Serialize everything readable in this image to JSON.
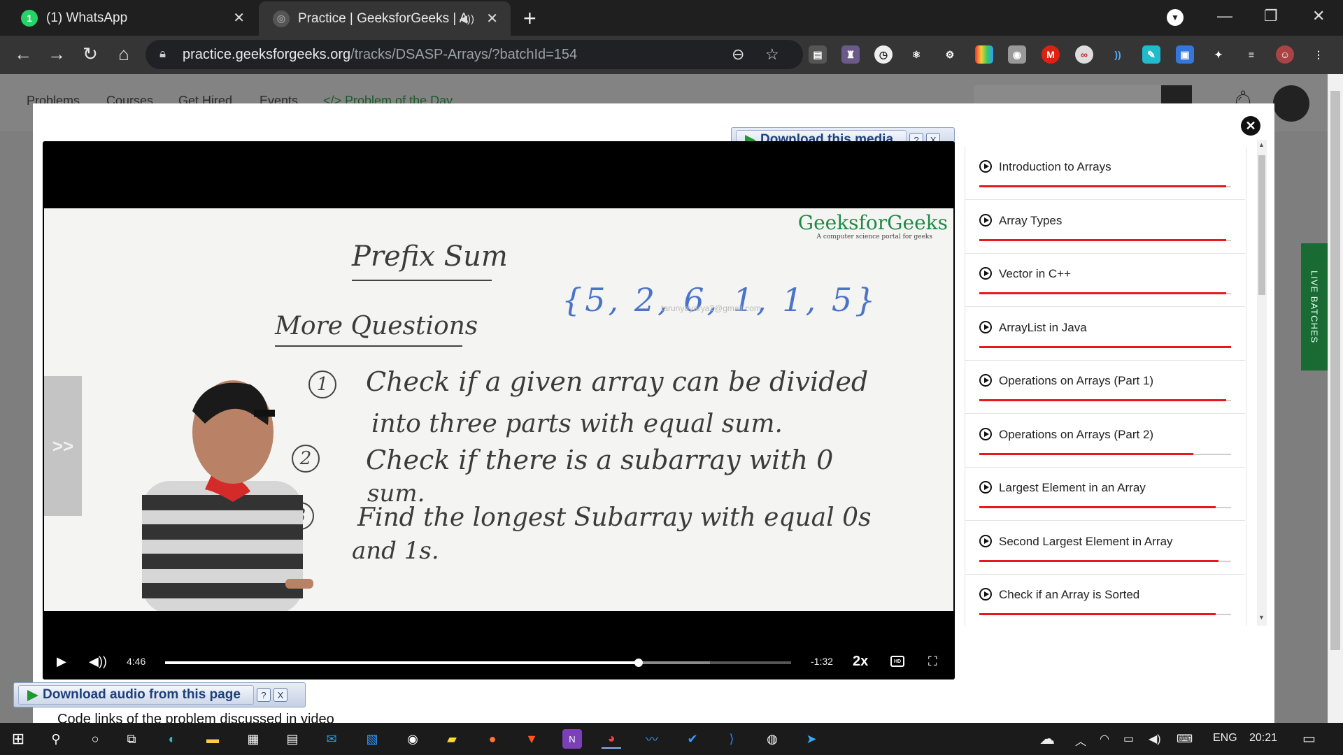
{
  "tabs": [
    {
      "title": "(1) WhatsApp",
      "badge": "1"
    },
    {
      "title": "Practice | GeeksforGeeks | A"
    }
  ],
  "window": {
    "minimize": "—",
    "restore": "❐",
    "close": "✕"
  },
  "address": {
    "host": "practice.geeksforgeeks.org",
    "path": "/tracks/DSASP-Arrays/?batchId=154"
  },
  "site_nav": {
    "problems": "Problems",
    "courses": "Courses",
    "get_hired": "Get Hired",
    "events": "Events",
    "potd": "</> Problem of the Day",
    "live": "LIVE BATCHES"
  },
  "media": {
    "download_media": "Download this media",
    "download_audio": "Download audio from this page",
    "help": "?",
    "close": "X"
  },
  "video": {
    "watermark": "GeeksforGeeks",
    "watermark_sub": "A computer science portal for geeks",
    "email": "tarunyayarya2@gmail.com",
    "board": {
      "title": "Prefix Sum",
      "array": "{5, 2, 6, 1, 1, 5}",
      "subtitle": "More Questions",
      "n1": "1",
      "q1a": "Check if a given array can be divided",
      "q1b": "into three parts with equal sum.",
      "n2": "2",
      "q2a": "Check if there is a subarray with 0",
      "q2b": "sum.",
      "n3": "3",
      "q3a": "Find the longest Subarray with equal 0s",
      "q3b": "and 1s."
    },
    "side_handle": ">>",
    "elapsed": "4:46",
    "remaining": "-1:32",
    "progress": 0.756,
    "speed": "2x",
    "hd": "HD"
  },
  "playlist": [
    {
      "title": "Introduction to Arrays",
      "progress": 0.98
    },
    {
      "title": "Array Types",
      "progress": 0.98
    },
    {
      "title": "Vector in C++",
      "progress": 0.98
    },
    {
      "title": "ArrayList in Java",
      "progress": 1.0
    },
    {
      "title": "Operations on Arrays (Part 1)",
      "progress": 0.98
    },
    {
      "title": "Operations on Arrays (Part 2)",
      "progress": 0.85
    },
    {
      "title": "Largest Element in an Array",
      "progress": 0.94
    },
    {
      "title": "Second Largest Element in Array",
      "progress": 0.95
    },
    {
      "title": "Check if an Array is Sorted",
      "progress": 0.94
    }
  ],
  "below_video": "Code links of the problem discussed in video",
  "taskbar": {
    "lang": "ENG",
    "time": "20:21"
  },
  "colors": {
    "gfg_green": "#1e8a45",
    "progress_red": "#e8191e"
  }
}
